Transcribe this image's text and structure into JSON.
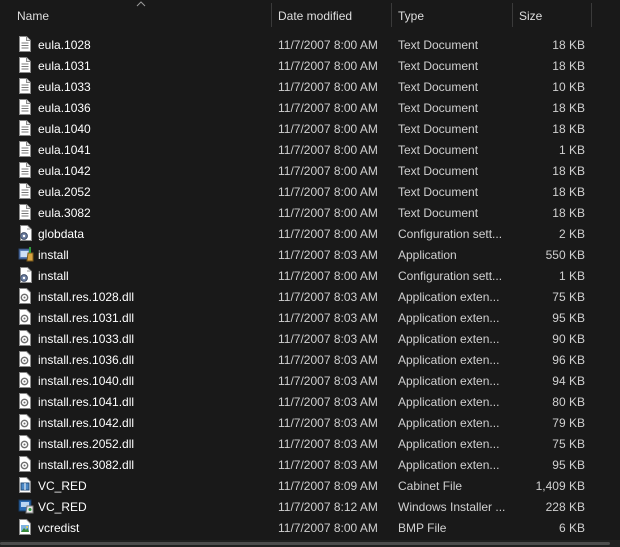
{
  "columns": {
    "name": "Name",
    "date": "Date modified",
    "type": "Type",
    "size": "Size"
  },
  "files": [
    {
      "icon": "text-document-icon",
      "name": "eula.1028",
      "date": "11/7/2007 8:00 AM",
      "type": "Text Document",
      "size": "18 KB"
    },
    {
      "icon": "text-document-icon",
      "name": "eula.1031",
      "date": "11/7/2007 8:00 AM",
      "type": "Text Document",
      "size": "18 KB"
    },
    {
      "icon": "text-document-icon",
      "name": "eula.1033",
      "date": "11/7/2007 8:00 AM",
      "type": "Text Document",
      "size": "10 KB"
    },
    {
      "icon": "text-document-icon",
      "name": "eula.1036",
      "date": "11/7/2007 8:00 AM",
      "type": "Text Document",
      "size": "18 KB"
    },
    {
      "icon": "text-document-icon",
      "name": "eula.1040",
      "date": "11/7/2007 8:00 AM",
      "type": "Text Document",
      "size": "18 KB"
    },
    {
      "icon": "text-document-icon",
      "name": "eula.1041",
      "date": "11/7/2007 8:00 AM",
      "type": "Text Document",
      "size": "1 KB"
    },
    {
      "icon": "text-document-icon",
      "name": "eula.1042",
      "date": "11/7/2007 8:00 AM",
      "type": "Text Document",
      "size": "18 KB"
    },
    {
      "icon": "text-document-icon",
      "name": "eula.2052",
      "date": "11/7/2007 8:00 AM",
      "type": "Text Document",
      "size": "18 KB"
    },
    {
      "icon": "text-document-icon",
      "name": "eula.3082",
      "date": "11/7/2007 8:00 AM",
      "type": "Text Document",
      "size": "18 KB"
    },
    {
      "icon": "config-file-icon",
      "name": "globdata",
      "date": "11/7/2007 8:00 AM",
      "type": "Configuration sett...",
      "size": "2 KB"
    },
    {
      "icon": "installer-app-icon",
      "name": "install",
      "date": "11/7/2007 8:03 AM",
      "type": "Application",
      "size": "550 KB"
    },
    {
      "icon": "config-file-icon",
      "name": "install",
      "date": "11/7/2007 8:00 AM",
      "type": "Configuration sett...",
      "size": "1 KB"
    },
    {
      "icon": "dll-file-icon",
      "name": "install.res.1028.dll",
      "date": "11/7/2007 8:03 AM",
      "type": "Application exten...",
      "size": "75 KB"
    },
    {
      "icon": "dll-file-icon",
      "name": "install.res.1031.dll",
      "date": "11/7/2007 8:03 AM",
      "type": "Application exten...",
      "size": "95 KB"
    },
    {
      "icon": "dll-file-icon",
      "name": "install.res.1033.dll",
      "date": "11/7/2007 8:03 AM",
      "type": "Application exten...",
      "size": "90 KB"
    },
    {
      "icon": "dll-file-icon",
      "name": "install.res.1036.dll",
      "date": "11/7/2007 8:03 AM",
      "type": "Application exten...",
      "size": "96 KB"
    },
    {
      "icon": "dll-file-icon",
      "name": "install.res.1040.dll",
      "date": "11/7/2007 8:03 AM",
      "type": "Application exten...",
      "size": "94 KB"
    },
    {
      "icon": "dll-file-icon",
      "name": "install.res.1041.dll",
      "date": "11/7/2007 8:03 AM",
      "type": "Application exten...",
      "size": "80 KB"
    },
    {
      "icon": "dll-file-icon",
      "name": "install.res.1042.dll",
      "date": "11/7/2007 8:03 AM",
      "type": "Application exten...",
      "size": "79 KB"
    },
    {
      "icon": "dll-file-icon",
      "name": "install.res.2052.dll",
      "date": "11/7/2007 8:03 AM",
      "type": "Application exten...",
      "size": "75 KB"
    },
    {
      "icon": "dll-file-icon",
      "name": "install.res.3082.dll",
      "date": "11/7/2007 8:03 AM",
      "type": "Application exten...",
      "size": "95 KB"
    },
    {
      "icon": "cabinet-file-icon",
      "name": "VC_RED",
      "date": "11/7/2007 8:09 AM",
      "type": "Cabinet File",
      "size": "1,409 KB"
    },
    {
      "icon": "msi-installer-icon",
      "name": "VC_RED",
      "date": "11/7/2007 8:12 AM",
      "type": "Windows Installer ...",
      "size": "228 KB"
    },
    {
      "icon": "bmp-image-icon",
      "name": "vcredist",
      "date": "11/7/2007 8:00 AM",
      "type": "BMP File",
      "size": "6 KB"
    }
  ]
}
